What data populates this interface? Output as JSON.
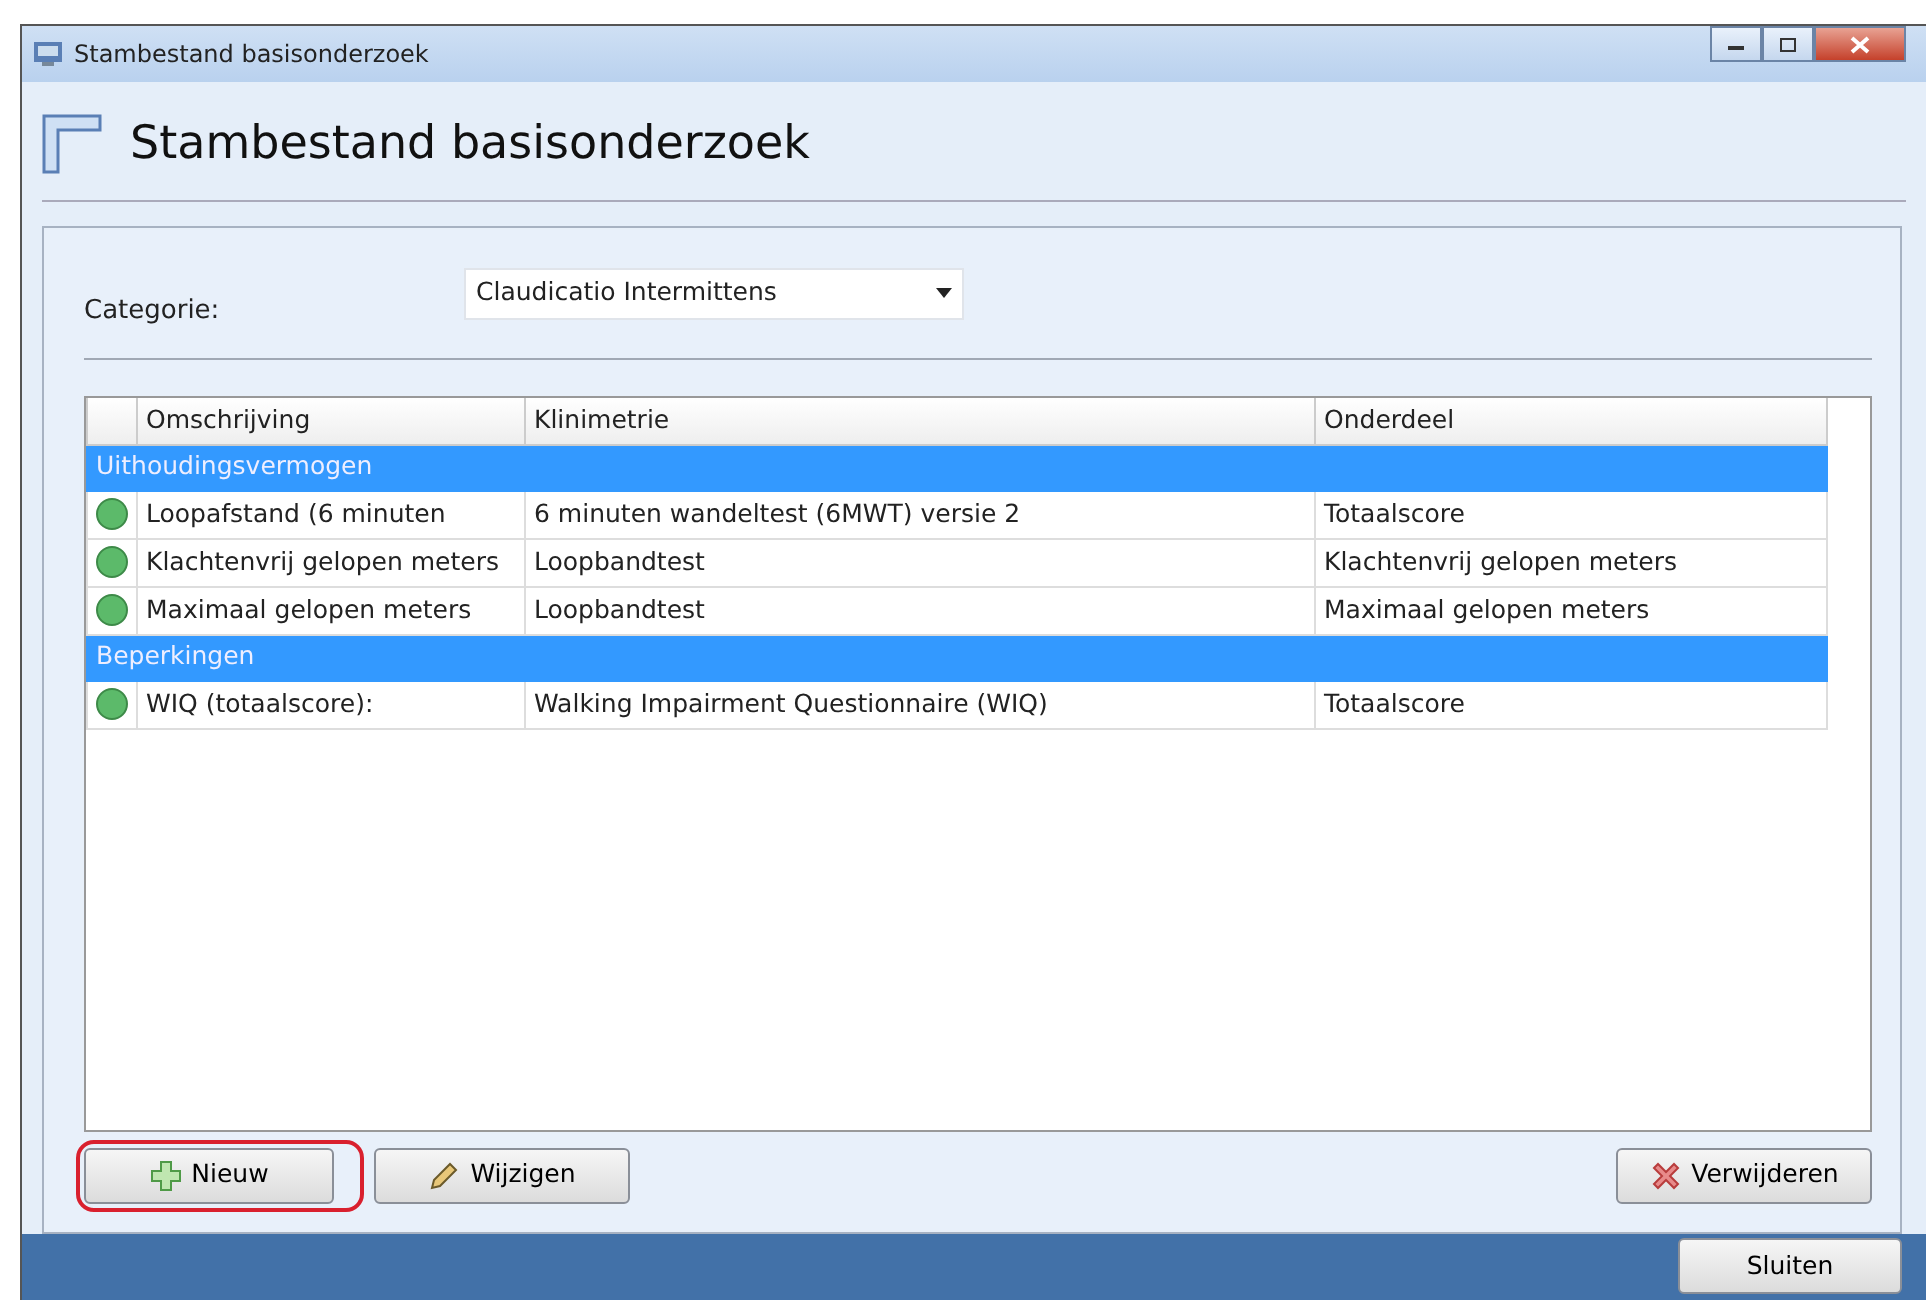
{
  "window": {
    "title": "Stambestand basisonderzoek"
  },
  "header": {
    "title": "Stambestand basisonderzoek"
  },
  "category": {
    "label": "Categorie:",
    "value": "Claudicatio Intermittens"
  },
  "table": {
    "columns": [
      "Omschrijving",
      "Klinimetrie",
      "Onderdeel"
    ],
    "rows": [
      {
        "kind": "group",
        "label": "Uithoudingsvermogen"
      },
      {
        "kind": "item",
        "cells": [
          "Loopafstand (6 minuten",
          "6 minuten wandeltest (6MWT) versie 2",
          "Totaalscore"
        ]
      },
      {
        "kind": "item",
        "cells": [
          "Klachtenvrij gelopen meters",
          "Loopbandtest",
          "Klachtenvrij gelopen meters"
        ]
      },
      {
        "kind": "item",
        "cells": [
          "Maximaal gelopen meters",
          "Loopbandtest",
          "Maximaal gelopen meters"
        ]
      },
      {
        "kind": "group",
        "label": "Beperkingen"
      },
      {
        "kind": "item",
        "cells": [
          "WIQ (totaalscore):",
          "Walking Impairment Questionnaire (WIQ)",
          "Totaalscore"
        ]
      }
    ]
  },
  "buttons": [
    {
      "kind": "add",
      "label": "Nieuw",
      "highlighted": true
    },
    {
      "kind": "edit",
      "label": "Wijzigen",
      "highlighted": false
    },
    {
      "kind": "delete",
      "label": "Verwijderen",
      "highlighted": false
    }
  ],
  "footer_button": {
    "label": "Sluiten"
  }
}
